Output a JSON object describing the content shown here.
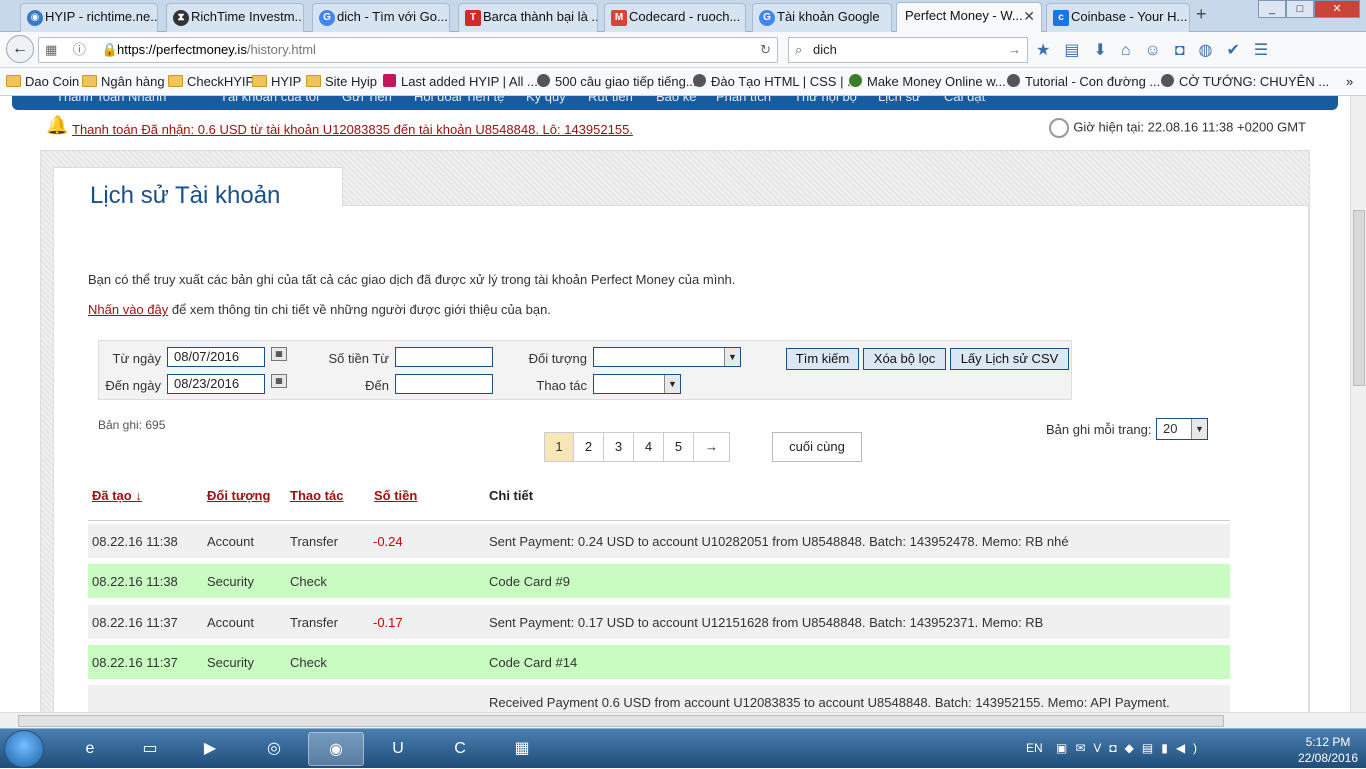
{
  "browser": {
    "tabs": [
      {
        "title": "HYIP - richtime.ne...",
        "icon": "globe-icon",
        "color": "#3a78c8"
      },
      {
        "title": "RichTime Investm...",
        "icon": "hourglass-icon",
        "color": "#333333"
      },
      {
        "title": "dich - Tìm với Go...",
        "icon": "google-icon",
        "color": "#4285f4"
      },
      {
        "title": "Barca thành bại là ...",
        "icon": "t-logo-icon",
        "color": "#d12a2a"
      },
      {
        "title": "Codecard - ruoch...",
        "icon": "gmail-icon",
        "color": "#d44638"
      },
      {
        "title": "Tài khoản Google",
        "icon": "google-icon",
        "color": "#4285f4"
      },
      {
        "title": "Perfect Money - W...",
        "icon": "none",
        "color": "#f7f9fb"
      },
      {
        "title": "Coinbase - Your H...",
        "icon": "coinbase-icon",
        "color": "#1a73e8"
      }
    ],
    "url_host": "https://perfectmoney.is",
    "url_path": "/history.html",
    "search_value": "dich",
    "bookmarks": [
      "Dao Coin",
      "Ngân hàng",
      "CheckHYIP",
      "HYIP",
      "Site Hyip",
      "Last added HYIP | All ...",
      "500 câu giao tiếp tiếng...",
      "Đào Tạo HTML | CSS | ...",
      "Make Money Online w...",
      "Tutorial - Con đường ...",
      "CỜ TƯỚNG: CHUYÊN ..."
    ]
  },
  "site": {
    "nav": [
      "Thanh Toán Nhanh",
      "Tài khoản của tôi",
      "Gửi Tiền",
      "Hối đoái Tiền tệ",
      "Ký quỹ",
      "Rút tiền",
      "Báo kê",
      "Phân tích",
      "Thư hội bộ",
      "Lịch sử",
      "Cài đặt"
    ],
    "notice": "Thanh toán Đã nhận: 0.6 USD từ tài khoản U12083835 đến tài khoản U8548848. Lô: 143952155.",
    "clock": "Giờ hiện tại: 22.08.16 11:38 +0200 GMT",
    "page_title": "Lịch sử Tài khoản",
    "description": "Bạn có thể truy xuất các bản ghi của tất cả các giao dịch đã được xử lý trong tài khoản Perfect Money của mình.",
    "referral_link": "Nhấn vào đây",
    "referral_text": " để xem thông tin chi tiết về những người được giới thiệu của bạn.",
    "filter": {
      "from_date_label": "Từ ngày",
      "from_date": "08/07/2016",
      "to_date_label": "Đến ngày",
      "to_date": "08/23/2016",
      "amount_from_label": "Số tiền Từ",
      "amount_to_label": "Đến",
      "counterparty_label": "Đối tượng",
      "operation_label": "Thao tác",
      "search_button": "Tìm kiếm",
      "clear_button": "Xóa bộ lọc",
      "csv_button": "Lấy Lịch sử CSV"
    },
    "records": "Bản ghi: 695",
    "per_page_label": "Bản ghi mỗi trang:",
    "per_page_value": "20",
    "pages": [
      "1",
      "2",
      "3",
      "4",
      "5",
      "→"
    ],
    "last_page": "cuối cùng",
    "columns": [
      "Đã tạo ↓",
      "Đối tượng",
      "Thao tác",
      "Số tiền",
      "Chi tiết"
    ],
    "rows": [
      {
        "date": "08.22.16 11:38",
        "object": "Account",
        "op": "Transfer",
        "amount": "-0.24",
        "detail": "Sent Payment: 0.24 USD to account U10282051 from U8548848. Batch: 143952478. Memo: RB nhé",
        "type": "acc"
      },
      {
        "date": "08.22.16 11:38",
        "object": "Security",
        "op": "Check",
        "amount": "",
        "detail": "Code Card #9",
        "type": "sec"
      },
      {
        "date": "08.22.16 11:37",
        "object": "Account",
        "op": "Transfer",
        "amount": "-0.17",
        "detail": "Sent Payment: 0.17 USD to account U12151628 from U8548848. Batch: 143952371. Memo: RB",
        "type": "acc"
      },
      {
        "date": "08.22.16 11:37",
        "object": "Security",
        "op": "Check",
        "amount": "",
        "detail": "Code Card #14",
        "type": "sec"
      },
      {
        "date": "",
        "object": "",
        "op": "",
        "amount": "",
        "detail": "Received Payment 0.6 USD from account U12083835 to account U8548848. Batch: 143952155. Memo: API Payment.",
        "type": "acc"
      }
    ]
  },
  "taskbar": {
    "lang": "EN",
    "time": "5:12 PM",
    "date": "22/08/2016"
  }
}
